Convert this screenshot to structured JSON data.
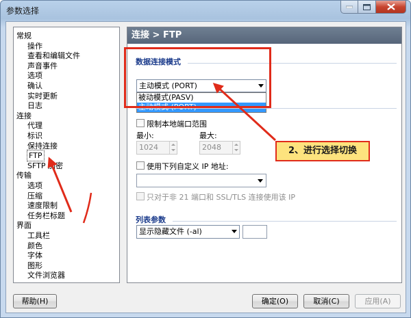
{
  "window": {
    "title": "参数选择"
  },
  "tree": {
    "items": [
      {
        "label": "常规",
        "level": 0
      },
      {
        "label": "操作",
        "level": 1
      },
      {
        "label": "查看和编辑文件",
        "level": 1
      },
      {
        "label": "声音事件",
        "level": 1
      },
      {
        "label": "选项",
        "level": 1
      },
      {
        "label": "确认",
        "level": 1
      },
      {
        "label": "实时更新",
        "level": 1
      },
      {
        "label": "日志",
        "level": 1
      },
      {
        "label": "连接",
        "level": 0
      },
      {
        "label": "代理",
        "level": 1
      },
      {
        "label": "标识",
        "level": 1
      },
      {
        "label": "保持连接",
        "level": 1
      },
      {
        "label": "FTP",
        "level": 1
      },
      {
        "label": "SFTP 加密",
        "level": 1
      },
      {
        "label": "传输",
        "level": 0
      },
      {
        "label": "选项",
        "level": 1
      },
      {
        "label": "压缩",
        "level": 1
      },
      {
        "label": "速度限制",
        "level": 1
      },
      {
        "label": "任务栏标题",
        "level": 1
      },
      {
        "label": "界面",
        "level": 0
      },
      {
        "label": "工具栏",
        "level": 1
      },
      {
        "label": "颜色",
        "level": 1
      },
      {
        "label": "字体",
        "level": 1
      },
      {
        "label": "图形",
        "level": 1
      },
      {
        "label": "文件浏览器",
        "level": 1
      }
    ]
  },
  "panel": {
    "header": "连接 > FTP",
    "data_mode": {
      "title": "数据连接模式",
      "selected": "主动模式 (PORT)",
      "options": [
        "被动模式(PASV)",
        "主动模式 (PORT)"
      ]
    },
    "local_ports": {
      "checkbox_label": "限制本地端口范围",
      "min_label": "最小:",
      "min_value": "1024",
      "max_label": "最大:",
      "max_value": "2048"
    },
    "custom_ip": {
      "checkbox_label": "使用下列自定义 IP 地址:",
      "only21_label": "只对于非 21 端口和 SSL/TLS 连接使用该 IP"
    },
    "list_params": {
      "title": "列表参数",
      "selected": "显示隐藏文件 (-al)"
    }
  },
  "buttons": {
    "help": "帮助(H)",
    "ok": "确定(O)",
    "cancel": "取消(C)",
    "apply": "应用(A)"
  },
  "annotation": {
    "callout": "2、进行选择切换",
    "color": "#e02b1a",
    "callout_bg": "#fde37e"
  }
}
